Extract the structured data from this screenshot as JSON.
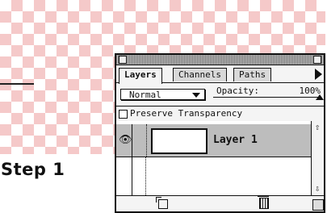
{
  "step": {
    "label": "Step 1"
  },
  "palette": {
    "tabs": [
      {
        "label": "Layers"
      },
      {
        "label": "Channels"
      },
      {
        "label": "Paths"
      }
    ],
    "blend_mode": "Normal",
    "opacity_label": "Opacity:",
    "opacity_value": "100%",
    "opacity_fraction": 1.0,
    "preserve_transparency_label": "Preserve Transparency",
    "preserve_transparency_checked": false,
    "layers": [
      {
        "name": "Layer 1",
        "visible": true,
        "selected": true
      }
    ],
    "icons": {
      "visibility": "eye-icon",
      "new_layer": "new-layer-icon",
      "delete": "trash-icon",
      "palette_menu": "menu-arrow-icon"
    }
  },
  "colors": {
    "checker_pink": "#f5c9c9",
    "selected_row": "#bdbdbd"
  }
}
